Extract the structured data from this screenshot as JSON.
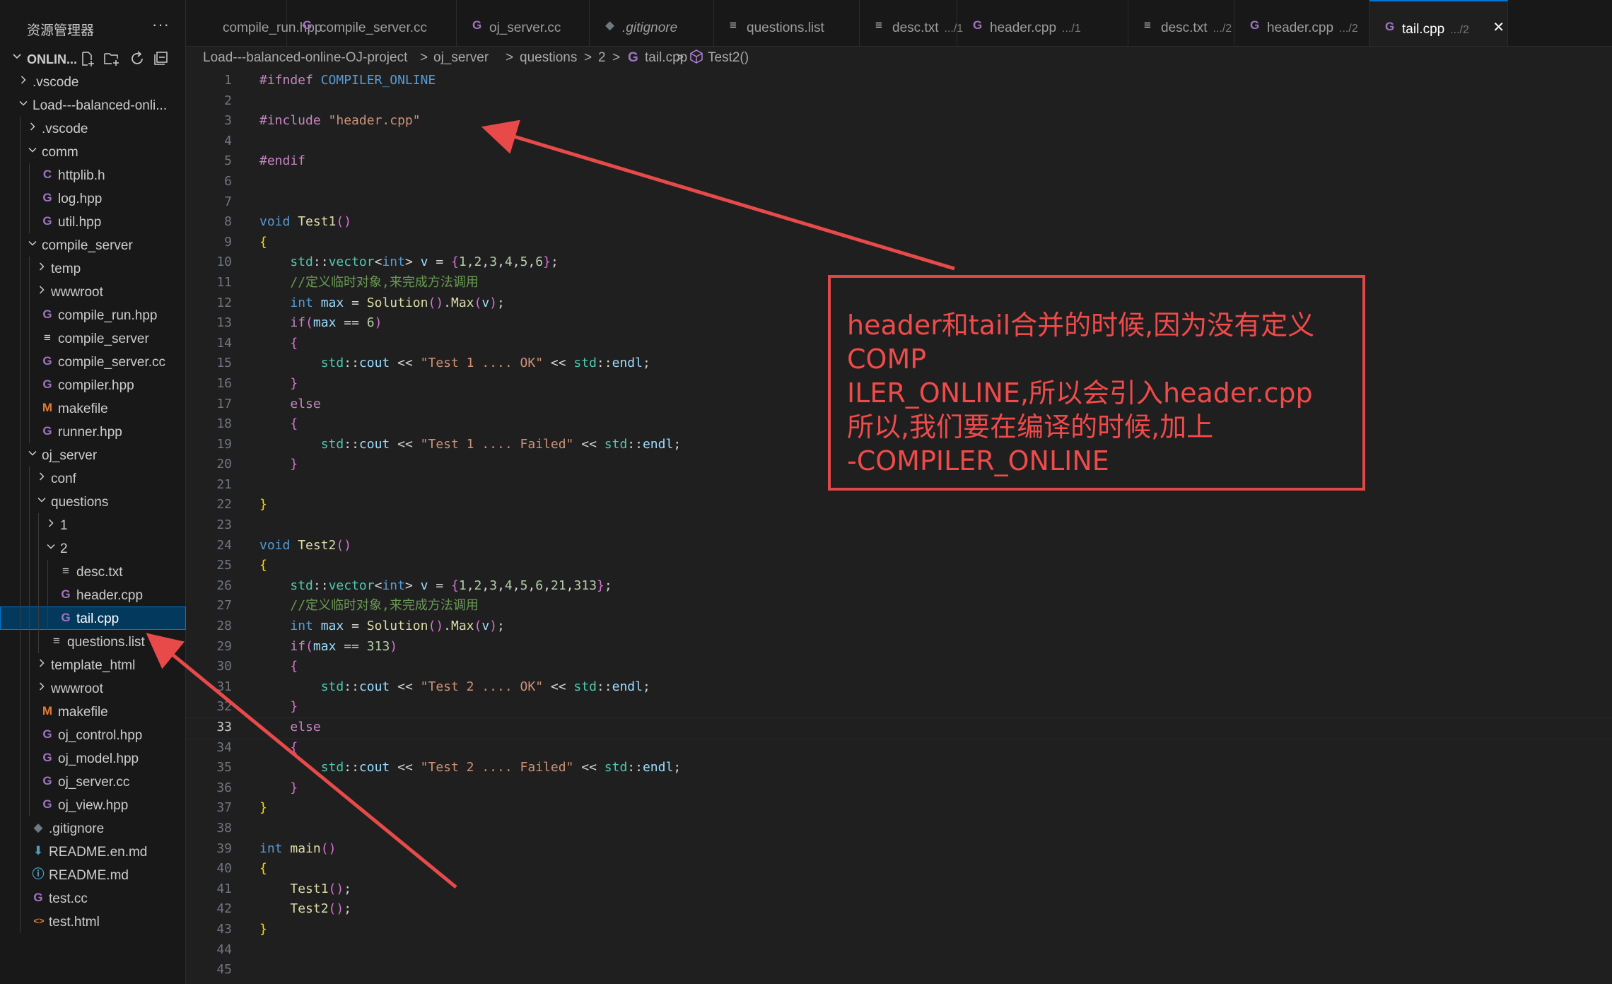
{
  "sidebar": {
    "title": "资源管理器",
    "root_label": "ONLIN...",
    "tree": [
      {
        "label": ".vscode",
        "depth": 1,
        "kind": "folder",
        "open": false
      },
      {
        "label": "Load---balanced-onli...",
        "depth": 1,
        "kind": "folder",
        "open": true
      },
      {
        "label": ".vscode",
        "depth": 2,
        "kind": "folder",
        "open": false
      },
      {
        "label": "comm",
        "depth": 2,
        "kind": "folder",
        "open": true
      },
      {
        "label": "httplib.h",
        "depth": 3,
        "kind": "c"
      },
      {
        "label": "log.hpp",
        "depth": 3,
        "kind": "cpp"
      },
      {
        "label": "util.hpp",
        "depth": 3,
        "kind": "cpp"
      },
      {
        "label": "compile_server",
        "depth": 2,
        "kind": "folder",
        "open": true
      },
      {
        "label": "temp",
        "depth": 3,
        "kind": "folder",
        "open": false
      },
      {
        "label": "wwwroot",
        "depth": 3,
        "kind": "folder",
        "open": false
      },
      {
        "label": "compile_run.hpp",
        "depth": 3,
        "kind": "cpp"
      },
      {
        "label": "compile_server",
        "depth": 3,
        "kind": "text"
      },
      {
        "label": "compile_server.cc",
        "depth": 3,
        "kind": "cpp"
      },
      {
        "label": "compiler.hpp",
        "depth": 3,
        "kind": "cpp"
      },
      {
        "label": "makefile",
        "depth": 3,
        "kind": "make"
      },
      {
        "label": "runner.hpp",
        "depth": 3,
        "kind": "cpp"
      },
      {
        "label": "oj_server",
        "depth": 2,
        "kind": "folder",
        "open": true
      },
      {
        "label": "conf",
        "depth": 3,
        "kind": "folder",
        "open": false
      },
      {
        "label": "questions",
        "depth": 3,
        "kind": "folder",
        "open": true
      },
      {
        "label": "1",
        "depth": 4,
        "kind": "folder",
        "open": false
      },
      {
        "label": "2",
        "depth": 4,
        "kind": "folder",
        "open": true
      },
      {
        "label": "desc.txt",
        "depth": 5,
        "kind": "text"
      },
      {
        "label": "header.cpp",
        "depth": 5,
        "kind": "cpp"
      },
      {
        "label": "tail.cpp",
        "depth": 5,
        "kind": "cpp",
        "selected": true
      },
      {
        "label": "questions.list",
        "depth": 4,
        "kind": "text"
      },
      {
        "label": "template_html",
        "depth": 3,
        "kind": "folder",
        "open": false
      },
      {
        "label": "wwwroot",
        "depth": 3,
        "kind": "folder",
        "open": false
      },
      {
        "label": "makefile",
        "depth": 3,
        "kind": "make"
      },
      {
        "label": "oj_control.hpp",
        "depth": 3,
        "kind": "cpp"
      },
      {
        "label": "oj_model.hpp",
        "depth": 3,
        "kind": "cpp"
      },
      {
        "label": "oj_server.cc",
        "depth": 3,
        "kind": "cpp"
      },
      {
        "label": "oj_view.hpp",
        "depth": 3,
        "kind": "cpp"
      },
      {
        "label": ".gitignore",
        "depth": 2,
        "kind": "git"
      },
      {
        "label": "README.en.md",
        "depth": 2,
        "kind": "md"
      },
      {
        "label": "README.md",
        "depth": 2,
        "kind": "info"
      },
      {
        "label": "test.cc",
        "depth": 2,
        "kind": "cpp"
      },
      {
        "label": "test.html",
        "depth": 2,
        "kind": "html"
      }
    ]
  },
  "tabs": [
    {
      "label": "compile_run.hpp",
      "desc": "",
      "icon": "none"
    },
    {
      "label": "compile_server.cc",
      "desc": "",
      "icon": "cpp"
    },
    {
      "label": "oj_server.cc",
      "desc": "",
      "icon": "cpp"
    },
    {
      "label": ".gitignore",
      "desc": "",
      "icon": "git"
    },
    {
      "label": "questions.list",
      "desc": "",
      "icon": "text"
    },
    {
      "label": "desc.txt",
      "desc": ".../1",
      "icon": "text"
    },
    {
      "label": "header.cpp",
      "desc": ".../1",
      "icon": "cpp"
    },
    {
      "label": "desc.txt",
      "desc": ".../2",
      "icon": "text"
    },
    {
      "label": "header.cpp",
      "desc": ".../2",
      "icon": "cpp"
    },
    {
      "label": "tail.cpp",
      "desc": ".../2",
      "icon": "cpp",
      "active": true
    }
  ],
  "breadcrumb": {
    "items": [
      "Load---balanced-online-OJ-project",
      "oj_server",
      "questions",
      "2",
      "tail.cpp",
      "Test2()"
    ],
    "separator": ">"
  },
  "editor": {
    "current_line": 33,
    "line_count": 45,
    "lines": [
      "#ifndef COMPILER_ONLINE",
      "",
      "#include \"header.cpp\"",
      "",
      "#endif",
      "",
      "",
      "void Test1()",
      "{",
      "    std::vector<int> v = {1,2,3,4,5,6};",
      "    //定义临时对象,来完成方法调用",
      "    int max = Solution().Max(v);",
      "    if(max == 6)",
      "    {",
      "        std::cout << \"Test 1 .... OK\" << std::endl;",
      "    }",
      "    else",
      "    {",
      "        std::cout << \"Test 1 .... Failed\" << std::endl;",
      "    }",
      "",
      "}",
      "",
      "void Test2()",
      "{",
      "    std::vector<int> v = {1,2,3,4,5,6,21,313};",
      "    //定义临时对象,来完成方法调用",
      "    int max = Solution().Max(v);",
      "    if(max == 313)",
      "    {",
      "        std::cout << \"Test 2 .... OK\" << std::endl;",
      "    }",
      "    else",
      "    {",
      "        std::cout << \"Test 2 .... Failed\" << std::endl;",
      "    }",
      "}",
      "",
      "int main()",
      "{",
      "    Test1();",
      "    Test2();",
      "}",
      "",
      ""
    ]
  },
  "annotation": {
    "text": "header和tail合并的时候,因为没有定义COMP\nILER_ONLINE,所以会引入header.cpp\n所以,我们要在编译的时候,加上\n-COMPILER_ONLINE",
    "color": "#e04848"
  },
  "colors": {
    "accent": "#0078d4",
    "cpp_icon": "#a074c4",
    "c_icon": "#a074c4",
    "make_icon": "#e37933",
    "git_icon": "#41535b",
    "md_icon": "#519aba",
    "html_icon": "#e37933"
  }
}
